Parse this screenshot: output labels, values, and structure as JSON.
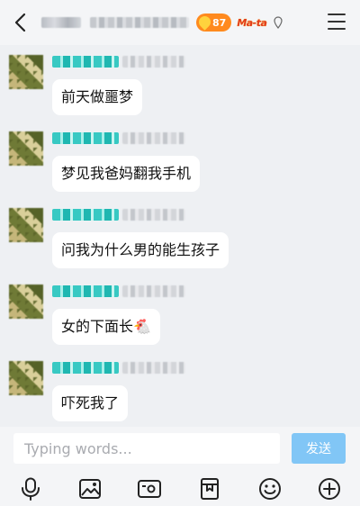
{
  "messages": [
    {
      "text": "前天做噩梦"
    },
    {
      "text": "梦见我爸妈翻我手机"
    },
    {
      "text": "问我为什么男的能生孩子"
    },
    {
      "text": "女的下面长🐔"
    },
    {
      "text": "吓死我了"
    }
  ],
  "header": {
    "fire_badge_value": "87",
    "game_badge_text": "Ma-ta"
  },
  "input": {
    "placeholder": "Typing words...",
    "send_label": "发送"
  },
  "toolbar": {
    "icons": [
      "microphone-icon",
      "image-icon",
      "camera-icon",
      "bookmark-icon",
      "emoji-icon",
      "plus-icon"
    ]
  },
  "colors": {
    "background": "#eef0f3",
    "send_button": "#81c6f6",
    "name_tag": "#38c9c3",
    "fire_badge": "#ff8a1e"
  }
}
